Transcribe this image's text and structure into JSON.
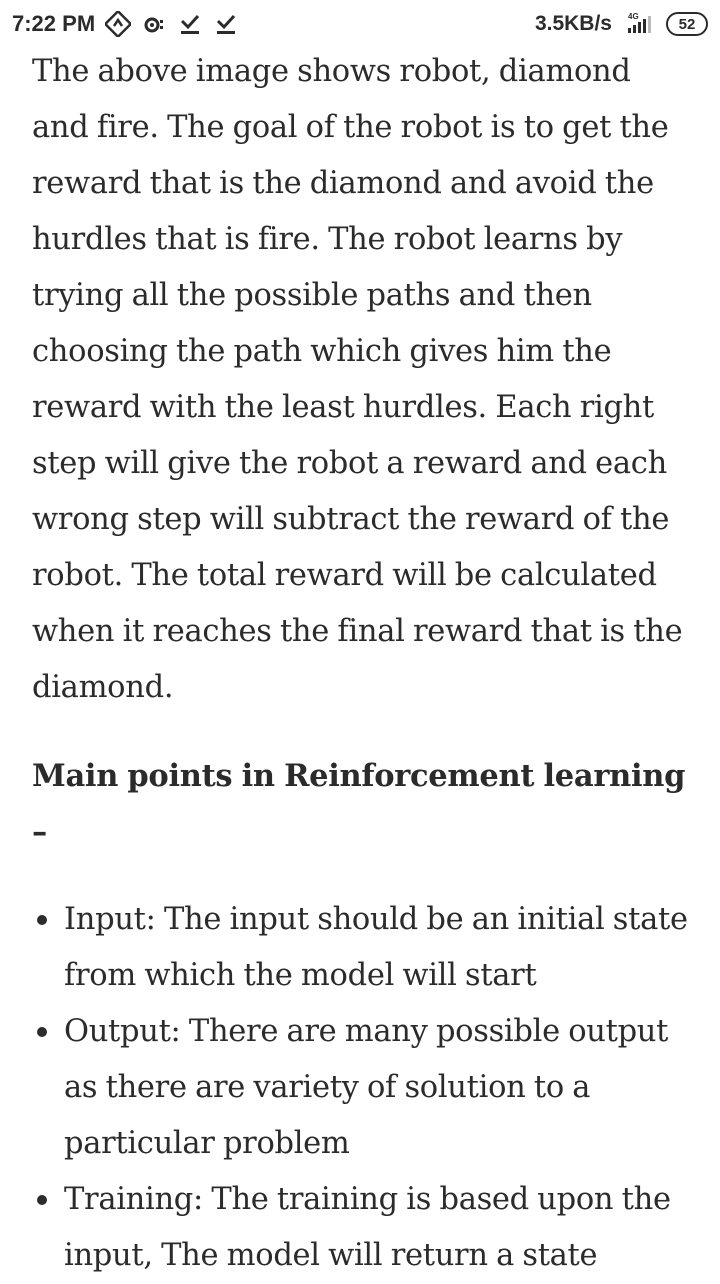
{
  "status_bar": {
    "time": "7:22 PM",
    "net_speed": "3.5KB/s",
    "network_type": "4G",
    "battery": "52",
    "icons": [
      "app-badge-icon",
      "hotspot-icon",
      "download-done-icon",
      "download-done-icon",
      "signal-icon"
    ]
  },
  "article": {
    "paragraph": "The above image shows robot, diamond and fire. The goal of the robot is to get the reward that is the diamond and avoid the hurdles that is fire. The robot learns by trying all the possible paths and then choosing the path which gives him the reward with the least hurdles. Each right step will give the robot a reward and each wrong step will subtract the reward of the robot. The total reward will be calculated when it reaches the final reward that is the diamond.",
    "heading": "Main points in Reinforcement learning –",
    "bullets": [
      {
        "text": "Input: The input should be an initial state from which the model will start"
      },
      {
        "text": "Output: There are many possible output as there are variety of solution to a particular problem"
      },
      {
        "text": "Training: The training is based upon the input, The model will return a state"
      }
    ]
  }
}
